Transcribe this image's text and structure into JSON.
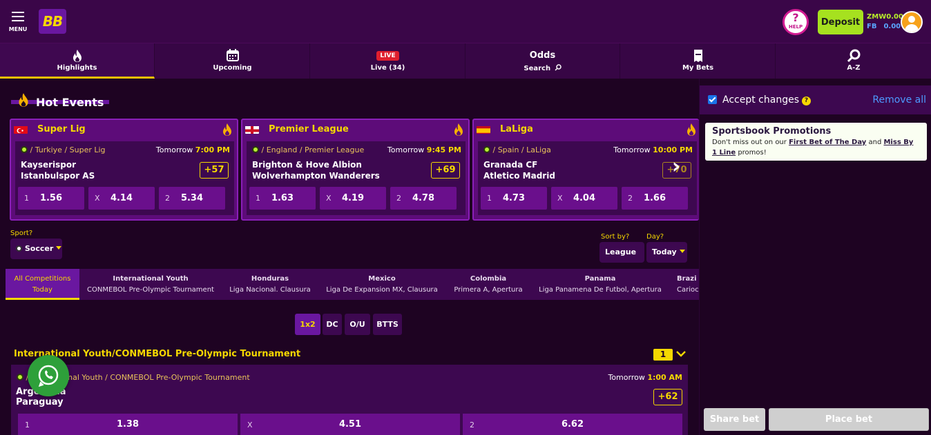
{
  "header": {
    "menu_label": "MENU",
    "logo_text": "BB",
    "help_label": "HELP",
    "deposit_label": "Deposit",
    "balances": [
      {
        "currency": "ZMW",
        "amount": "0.00"
      },
      {
        "currency": "FB",
        "amount": "0.00"
      }
    ]
  },
  "nav": {
    "items": [
      {
        "label": "Highlights",
        "icon": "flame-icon",
        "active": true
      },
      {
        "label": "Upcoming",
        "icon": "calendar-icon"
      },
      {
        "label": "Live (34)",
        "badge": "LIVE"
      },
      {
        "title": "Odds",
        "label": "Search",
        "icon": "search-icon"
      },
      {
        "label": "My Bets",
        "icon": "ticket-icon"
      },
      {
        "label": "A-Z",
        "icon": "search-icon"
      }
    ]
  },
  "hot_events": {
    "title": "Hot Events",
    "cards": [
      {
        "league": "Super Lig",
        "flag": "turkey-flag",
        "path": "/ Turkiye / Super Lig",
        "day": "Tomorrow",
        "time": "7:00 PM",
        "home": "Kayserispor",
        "away": "Istanbulspor AS",
        "more": "+57",
        "odds": [
          {
            "label": "1",
            "value": "1.56"
          },
          {
            "label": "X",
            "value": "4.14"
          },
          {
            "label": "2",
            "value": "5.34"
          }
        ]
      },
      {
        "league": "Premier League",
        "flag": "england-flag",
        "path": "/ England / Premier League",
        "day": "Tomorrow",
        "time": "9:45 PM",
        "home": "Brighton & Hove Albion",
        "away": "Wolverhampton Wanderers",
        "more": "+69",
        "odds": [
          {
            "label": "1",
            "value": "1.63"
          },
          {
            "label": "X",
            "value": "4.19"
          },
          {
            "label": "2",
            "value": "4.78"
          }
        ]
      },
      {
        "league": "LaLiga",
        "flag": "spain-flag",
        "path": "/ Spain / LaLiga",
        "day": "Tomorrow",
        "time": "10:00 PM",
        "home": "Granada CF",
        "away": "Atletico Madrid",
        "more": "+70",
        "odds": [
          {
            "label": "1",
            "value": "4.73"
          },
          {
            "label": "X",
            "value": "4.04"
          },
          {
            "label": "2",
            "value": "1.66"
          }
        ]
      }
    ]
  },
  "filters": {
    "sport_label": "Sport?",
    "sport_value": "Soccer",
    "sort_label": "Sort by?",
    "sort_value": "League",
    "day_label": "Day?",
    "day_value": "Today"
  },
  "competitions": [
    {
      "line1": "All Competitions",
      "line2": "Today",
      "active": true
    },
    {
      "line1": "International Youth",
      "line2": "CONMEBOL Pre-Olympic Tournament"
    },
    {
      "line1": "Honduras",
      "line2": "Liga Nacional. Clausura"
    },
    {
      "line1": "Mexico",
      "line2": "Liga De Expansion MX, Clausura"
    },
    {
      "line1": "Colombia",
      "line2": "Primera A, Apertura"
    },
    {
      "line1": "Panama",
      "line2": "Liga Panamena De Futbol, Apertura"
    },
    {
      "line1": "Brazi",
      "line2": "Carioc"
    }
  ],
  "markets": [
    {
      "label": "1x2",
      "active": true
    },
    {
      "label": "DC"
    },
    {
      "label": "O/U"
    },
    {
      "label": "BTTS"
    }
  ],
  "section": {
    "title": "International Youth/CONMEBOL Pre-Olympic Tournament",
    "count": "1",
    "event": {
      "path": "/ International Youth / CONMEBOL Pre-Olympic Tournament",
      "day": "Tomorrow",
      "time": "1:00 AM",
      "home": "Argentina",
      "away": "Paraguay",
      "more": "+62",
      "odds": [
        {
          "label": "1",
          "value": "1.38"
        },
        {
          "label": "X",
          "value": "4.51"
        },
        {
          "label": "2",
          "value": "6.62"
        }
      ]
    }
  },
  "betslip": {
    "accept_label": "Accept changes",
    "accept_checked": true,
    "remove_all": "Remove all",
    "promo_title": "Sportsbook Promotions",
    "promo_text_1": "Don't miss out on our ",
    "promo_link_1": "First Bet of The Day",
    "promo_text_2": " and ",
    "promo_link_2": "Miss By 1 Line",
    "promo_text_3": " promos!",
    "share_label": "Share bet",
    "place_label": "Place bet"
  },
  "colors": {
    "accent": "#f5d800",
    "brand": "#5d0c79",
    "deposit": "#a6e11f",
    "live": "#e01f2e"
  }
}
